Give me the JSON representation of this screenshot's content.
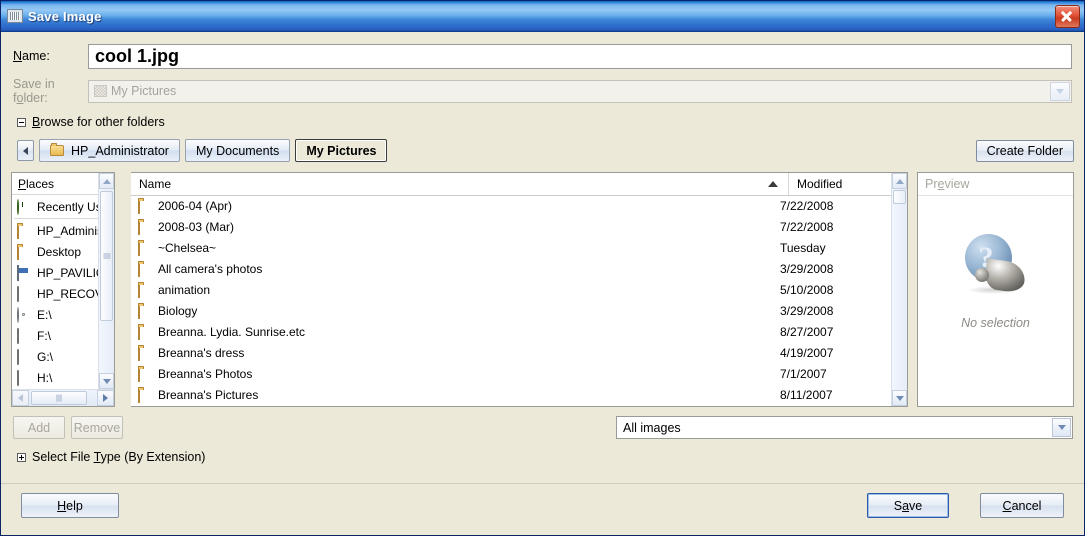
{
  "window": {
    "title": "Save Image",
    "icon": "image-icon",
    "close_label": "close-icon"
  },
  "form": {
    "name_label": "Name:",
    "name_value": "cool 1.jpg",
    "folder_label": "Save in folder:",
    "folder_value": "My Pictures",
    "folder_icon": "folder-thumbnail-icon"
  },
  "expanders": {
    "browse": "Browse for other folders",
    "filetype": "Select File Type (By Extension)"
  },
  "breadcrumbs": {
    "back_icon": "back-arrow-icon",
    "items": [
      {
        "label": "HP_Administrator",
        "active": false,
        "icon": "folder-icon"
      },
      {
        "label": "My Documents",
        "active": false,
        "icon": ""
      },
      {
        "label": "My Pictures",
        "active": true,
        "icon": ""
      }
    ],
    "create_folder": "Create Folder"
  },
  "places": {
    "header": "Places",
    "items": [
      {
        "label": "Recently Use",
        "icon": "recent-clock-icon"
      },
      {
        "label": "HP_Administr",
        "icon": "folder-icon"
      },
      {
        "label": "Desktop",
        "icon": "folder-icon"
      },
      {
        "label": "HP_PAVILION",
        "icon": "computer-icon"
      },
      {
        "label": "HP_RECOVER",
        "icon": "drive-icon"
      },
      {
        "label": "E:\\",
        "icon": "cd-drive-icon"
      },
      {
        "label": "F:\\",
        "icon": "drive-icon"
      },
      {
        "label": "G:\\",
        "icon": "drive-icon"
      },
      {
        "label": "H:\\",
        "icon": "drive-icon"
      }
    ]
  },
  "filelist": {
    "columns": {
      "name": "Name",
      "modified": "Modified"
    },
    "sort": "name-ascending",
    "rows": [
      {
        "name": "2006-04 (Apr)",
        "modified": "7/22/2008",
        "icon": "folder-icon"
      },
      {
        "name": "2008-03 (Mar)",
        "modified": "7/22/2008",
        "icon": "folder-icon"
      },
      {
        "name": "~Chelsea~",
        "modified": "Tuesday",
        "icon": "folder-icon"
      },
      {
        "name": "All camera's photos",
        "modified": "3/29/2008",
        "icon": "folder-icon"
      },
      {
        "name": "animation",
        "modified": "5/10/2008",
        "icon": "folder-icon"
      },
      {
        "name": "Biology",
        "modified": "3/29/2008",
        "icon": "folder-icon"
      },
      {
        "name": "Breanna. Lydia. Sunrise.etc",
        "modified": "8/27/2007",
        "icon": "folder-icon"
      },
      {
        "name": "Breanna's dress",
        "modified": "4/19/2007",
        "icon": "folder-icon"
      },
      {
        "name": "Breanna's Photos",
        "modified": "7/1/2007",
        "icon": "folder-icon"
      },
      {
        "name": "Breanna's Pictures",
        "modified": "8/11/2007",
        "icon": "folder-icon"
      }
    ]
  },
  "preview": {
    "header": "Preview",
    "no_selection": "No selection",
    "icon": "unknown-file-icon"
  },
  "buttons": {
    "add": "Add",
    "remove": "Remove",
    "help": "Help",
    "save": "Save",
    "cancel": "Cancel"
  },
  "filter": {
    "value": "All images"
  },
  "colors": {
    "titlebar_blue": "#3d8ce0",
    "dialog_bg": "#ece9d8",
    "close_red": "#c93b20",
    "focus_blue": "#2b5ba8"
  }
}
